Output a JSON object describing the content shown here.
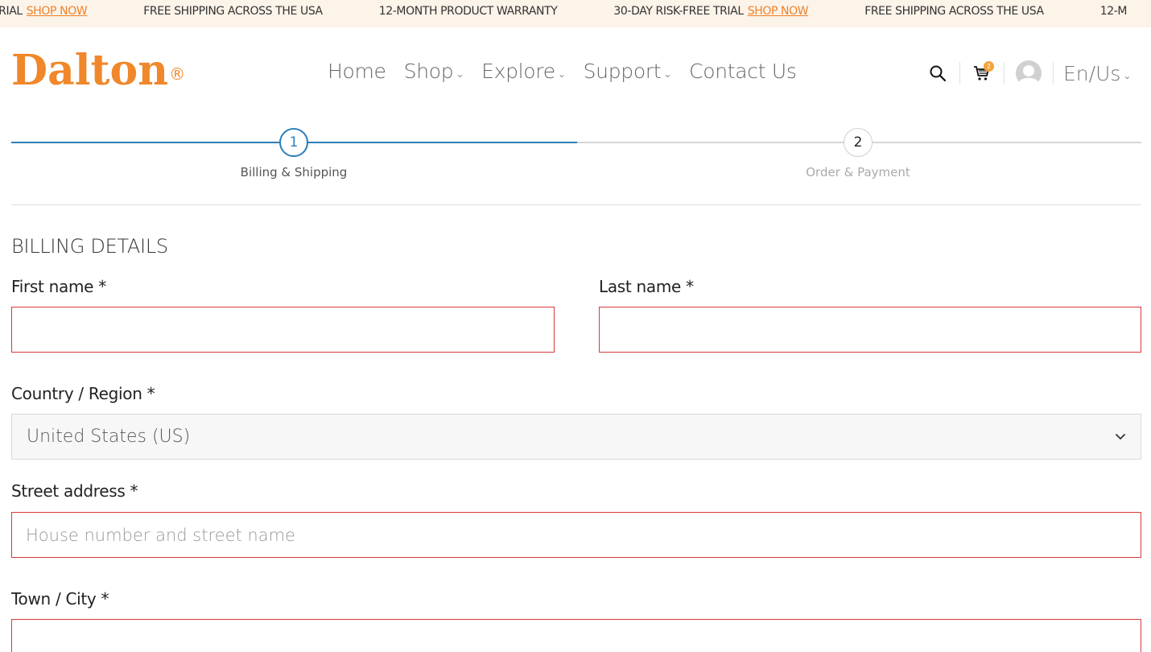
{
  "announcement": {
    "messages": [
      {
        "text": "TRIAL",
        "link": "SHOP NOW"
      },
      {
        "text": "FREE SHIPPING ACROSS THE USA",
        "link": ""
      },
      {
        "text": "12-MONTH PRODUCT WARRANTY",
        "link": ""
      },
      {
        "text": "30-DAY RISK-FREE TRIAL",
        "link": "SHOP NOW"
      },
      {
        "text": "FREE SHIPPING ACROSS THE USA",
        "link": ""
      },
      {
        "text": "12-M",
        "link": ""
      }
    ]
  },
  "header": {
    "logo_text": "Dalton",
    "logo_mark": "®",
    "nav": [
      {
        "label": "Home",
        "dropdown": false
      },
      {
        "label": "Shop",
        "dropdown": true
      },
      {
        "label": "Explore",
        "dropdown": true
      },
      {
        "label": "Support",
        "dropdown": true
      },
      {
        "label": "Contact Us",
        "dropdown": false
      }
    ],
    "cart_count": "2",
    "language": "En/Us",
    "icons": {
      "search": "search-icon",
      "cart": "cart-icon",
      "account": "user-avatar-icon",
      "chevron": "chevron-down-icon"
    },
    "chevron_glyph": "⌄"
  },
  "stepper": {
    "steps": [
      {
        "number": "1",
        "label": "Billing & Shipping",
        "active": true
      },
      {
        "number": "2",
        "label": "Order & Payment",
        "active": false
      }
    ],
    "active_color": "#2b7fb8"
  },
  "form": {
    "title": "BILLING DETAILS",
    "first_name": {
      "label": "First name *",
      "value": "",
      "placeholder": ""
    },
    "last_name": {
      "label": "Last name *",
      "value": "",
      "placeholder": ""
    },
    "country": {
      "label": "Country / Region *",
      "value": "United States (US)"
    },
    "street": {
      "label": "Street address *",
      "value": "",
      "placeholder": "House number and street name"
    },
    "city": {
      "label": "Town / City *",
      "value": "",
      "placeholder": ""
    },
    "error_border_color": "#d9393a"
  },
  "brand_color": "#f0872a"
}
